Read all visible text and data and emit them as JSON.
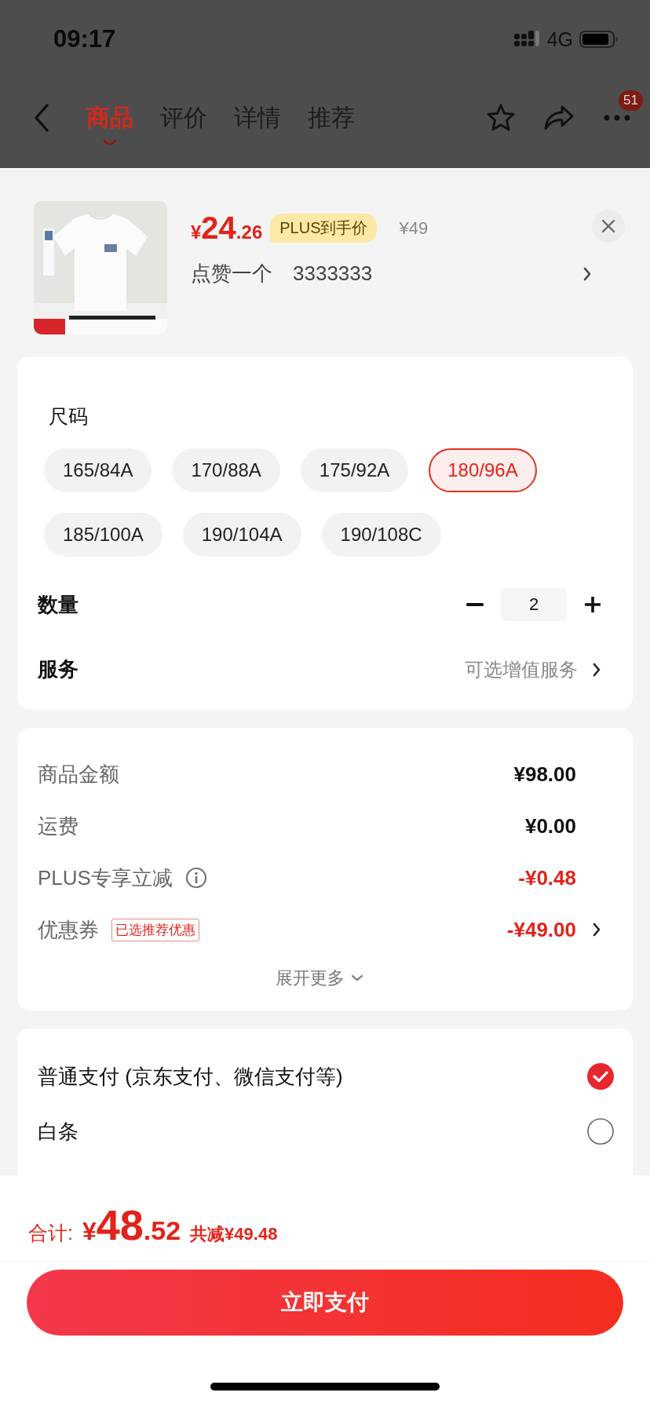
{
  "status_bar": {
    "time": "09:17",
    "network": "4G"
  },
  "nav": {
    "tabs": [
      {
        "label": "商品",
        "selected": true
      },
      {
        "label": "评价",
        "selected": false
      },
      {
        "label": "详情",
        "selected": false
      },
      {
        "label": "推荐",
        "selected": false
      }
    ],
    "badge": "51"
  },
  "product": {
    "price": {
      "currency": "¥",
      "integer": "24",
      "decimal": ".26"
    },
    "price_tag": "PLUS到手价",
    "original_price": "¥49",
    "spec_values": [
      "点赞一个",
      "3333333"
    ]
  },
  "size": {
    "label": "尺码",
    "options": [
      {
        "label": "165/84A",
        "selected": false
      },
      {
        "label": "170/88A",
        "selected": false
      },
      {
        "label": "175/92A",
        "selected": false
      },
      {
        "label": "180/96A",
        "selected": true
      },
      {
        "label": "185/100A",
        "selected": false
      },
      {
        "label": "190/104A",
        "selected": false
      },
      {
        "label": "190/108C",
        "selected": false
      }
    ]
  },
  "quantity": {
    "label": "数量",
    "value": "2"
  },
  "service": {
    "label": "服务",
    "value": "可选增值服务"
  },
  "costs": {
    "rows": [
      {
        "label": "商品金额",
        "value": "¥98.00",
        "kind": "charge",
        "info": false,
        "link": false
      },
      {
        "label": "运费",
        "value": "¥0.00",
        "kind": "charge",
        "info": false,
        "link": false
      },
      {
        "label": "PLUS专享立减",
        "value": "-¥0.48",
        "kind": "discount",
        "info": true,
        "link": false
      },
      {
        "label": "优惠券",
        "value": "-¥49.00",
        "kind": "discount",
        "info": false,
        "link": true,
        "tag": "已选推荐优惠"
      }
    ],
    "expand": "展开更多"
  },
  "payment": {
    "options": [
      {
        "label": "普通支付 (京东支付、微信支付等)",
        "selected": true
      },
      {
        "label": "白条",
        "selected": false
      }
    ]
  },
  "footer": {
    "total_label": "合计:",
    "total": {
      "currency": "¥",
      "integer": "48",
      "decimal": ".52"
    },
    "saving": "共减¥49.48",
    "pay_button": "立即支付"
  }
}
